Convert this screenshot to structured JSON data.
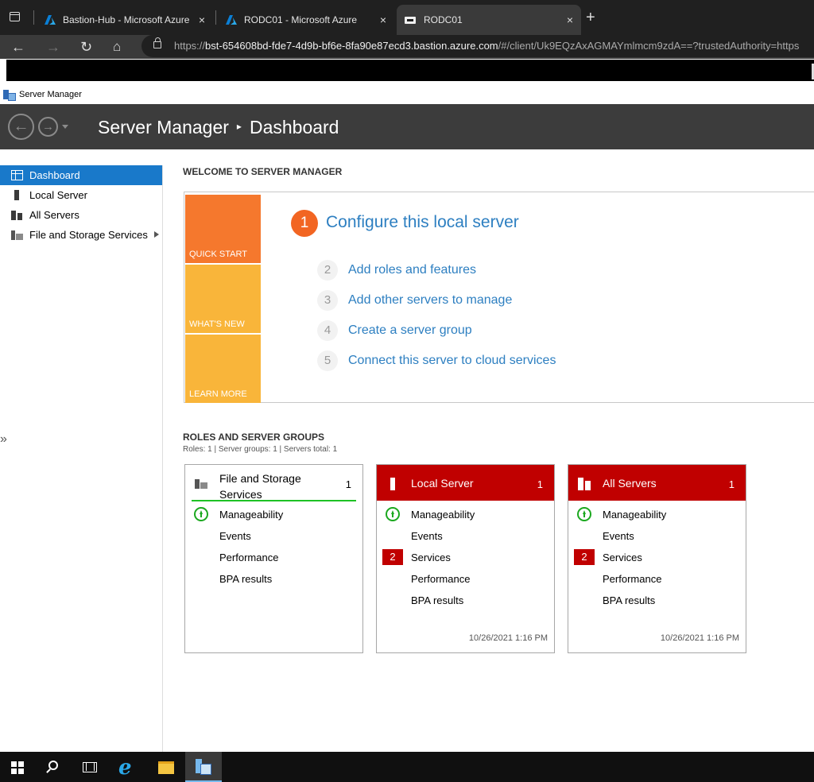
{
  "browser": {
    "tabs": [
      {
        "title": "Bastion-Hub - Microsoft Azure",
        "icon": "azure-icon"
      },
      {
        "title": "RODC01 - Microsoft Azure",
        "icon": "azure-icon"
      },
      {
        "title": "RODC01",
        "icon": "remote-desktop-icon",
        "active": true
      }
    ],
    "close_glyph": "×",
    "new_tab_glyph": "+",
    "url_prefix": "https://",
    "url_host": "bst-654608bd-fde7-4d9b-bf6e-8fa90e87ecd3.bastion.azure.com",
    "url_rest": "/#/client/Uk9EQzAxAGMAYmlmcm9zdA==?trustedAuthority=https"
  },
  "window": {
    "title": "Server Manager"
  },
  "header": {
    "app": "Server Manager",
    "page": "Dashboard",
    "separator": "▸"
  },
  "sidebar": {
    "items": [
      {
        "label": "Dashboard",
        "active": true
      },
      {
        "label": "Local Server"
      },
      {
        "label": "All Servers"
      },
      {
        "label": "File and Storage Services"
      }
    ],
    "collapse_glyph": "»"
  },
  "welcome": {
    "title": "WELCOME TO SERVER MANAGER",
    "tiles": [
      "QUICK START",
      "WHAT'S NEW",
      "LEARN MORE"
    ],
    "primary_step": {
      "num": "1",
      "label": "Configure this local server"
    },
    "steps": [
      {
        "num": "2",
        "label": "Add roles and features"
      },
      {
        "num": "3",
        "label": "Add other servers to manage"
      },
      {
        "num": "4",
        "label": "Create a server group"
      },
      {
        "num": "5",
        "label": "Connect this server to cloud services"
      }
    ]
  },
  "roles": {
    "title": "ROLES AND SERVER GROUPS",
    "summary": "Roles: 1   |   Server groups: 1   |   Servers total: 1",
    "cards": [
      {
        "name": "File and Storage Services",
        "count": "1",
        "metrics": [
          "Manageability",
          "Events",
          "Performance",
          "BPA results"
        ]
      },
      {
        "name": "Local Server",
        "count": "1",
        "metrics": [
          "Manageability",
          "Events",
          "Services",
          "Performance",
          "BPA results"
        ],
        "services_badge": "2",
        "timestamp": "10/26/2021 1:16 PM"
      },
      {
        "name": "All Servers",
        "count": "1",
        "metrics": [
          "Manageability",
          "Events",
          "Services",
          "Performance",
          "BPA results"
        ],
        "services_badge": "2",
        "timestamp": "10/26/2021 1:16 PM"
      }
    ]
  },
  "colors": {
    "accent": "#1979ca",
    "quick_start": "#f5782d",
    "tile_yellow": "#f9b53a",
    "alert_red": "#c00000",
    "ok_green": "#1ba81f",
    "link_blue": "#2d7fc1"
  }
}
